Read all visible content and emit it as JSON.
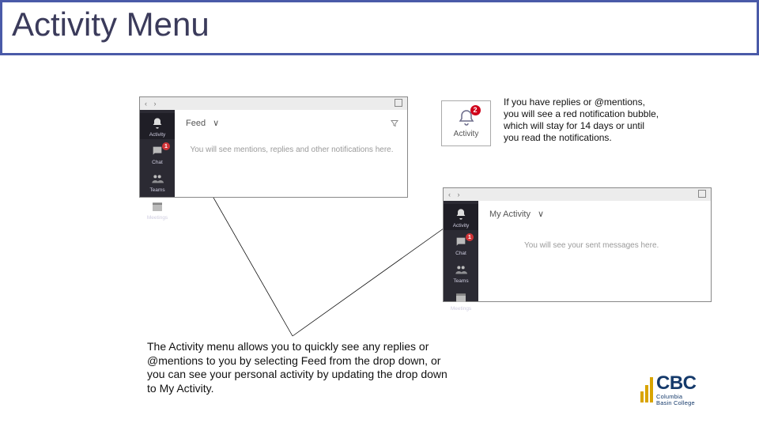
{
  "slide_title": "Activity Menu",
  "top_teams": {
    "header_label": "Feed",
    "message": "You will see mentions, replies and other notifications here.",
    "rail": [
      {
        "label": "Activity"
      },
      {
        "label": "Chat",
        "badge": "1"
      },
      {
        "label": "Teams"
      },
      {
        "label": "Meetings"
      }
    ]
  },
  "bottom_teams": {
    "header_label": "My Activity",
    "message": "You will see your sent messages here.",
    "rail": [
      {
        "label": "Activity"
      },
      {
        "label": "Chat",
        "badge": "1"
      },
      {
        "label": "Teams"
      },
      {
        "label": "Meetings"
      }
    ]
  },
  "activity_card": {
    "badge": "2",
    "label": "Activity"
  },
  "right_text": "If you have replies or @mentions, you will see a red notification bubble, which will stay for 14 days or until you read the notifications.",
  "bottom_text": "The Activity menu allows you to quickly see any replies or @mentions to you by selecting Feed from the drop down, or you can see your personal activity by updating the drop down to My Activity.",
  "logo": {
    "abbr": "CBC",
    "line1": "Columbia",
    "line2": "Basin College"
  }
}
